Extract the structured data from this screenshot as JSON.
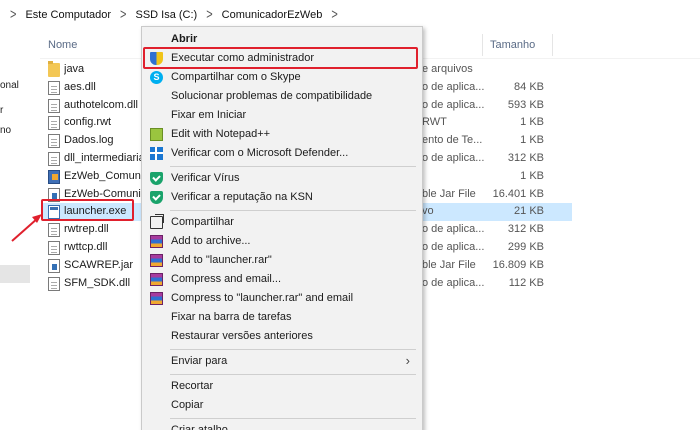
{
  "breadcrumb": [
    "Este Computador",
    "SSD Isa (C:)",
    "ComunicadorEzWeb"
  ],
  "sidebar_fragments": [
    "onal",
    "r",
    "no"
  ],
  "columns": {
    "name": "Nome",
    "size": "Tamanho"
  },
  "files": [
    {
      "name": "java",
      "type": "e arquivos",
      "size": "",
      "icon": "folder-icon"
    },
    {
      "name": "aes.dll",
      "type": "o de aplica...",
      "size": "84 KB",
      "icon": "file-icon"
    },
    {
      "name": "authotelcom.dll",
      "type": "o de aplica...",
      "size": "593 KB",
      "icon": "file-icon"
    },
    {
      "name": "config.rwt",
      "type": "RWT",
      "size": "1 KB",
      "icon": "file-icon"
    },
    {
      "name": "Dados.log",
      "type": "ento de Te...",
      "size": "1 KB",
      "icon": "file-icon"
    },
    {
      "name": "dll_intermediaria.",
      "type": "o de aplica...",
      "size": "312 KB",
      "icon": "file-icon"
    },
    {
      "name": "EzWeb_Comunic",
      "type": "",
      "size": "1 KB",
      "icon": "ezweb-icon"
    },
    {
      "name": "EzWeb-Comunic",
      "type": "ble Jar File",
      "size": "16.401 KB",
      "icon": "jar-icon"
    },
    {
      "name": "launcher.exe",
      "type": "vo",
      "size": "21 KB",
      "icon": "exe-icon",
      "selected": true
    },
    {
      "name": "rwtrep.dll",
      "type": "o de aplica...",
      "size": "312 KB",
      "icon": "file-icon"
    },
    {
      "name": "rwttcp.dll",
      "type": "o de aplica...",
      "size": "299 KB",
      "icon": "file-icon"
    },
    {
      "name": "SCAWREP.jar",
      "type": "ble Jar File",
      "size": "16.809 KB",
      "icon": "jar-icon"
    },
    {
      "name": "SFM_SDK.dll",
      "type": "o de aplica...",
      "size": "112 KB",
      "icon": "file-icon"
    }
  ],
  "menu": [
    {
      "label": "Abrir",
      "bold": true,
      "icon": ""
    },
    {
      "label": "Executar como administrador",
      "icon": "uac-shield-icon"
    },
    {
      "label": "Compartilhar com o Skype",
      "icon": "skype-icon"
    },
    {
      "label": "Solucionar problemas de compatibilidade",
      "icon": ""
    },
    {
      "label": "Fixar em Iniciar",
      "icon": ""
    },
    {
      "label": "Edit with Notepad++",
      "icon": "notepad-plus-icon"
    },
    {
      "label": "Verificar com o Microsoft Defender...",
      "icon": "defender-icon"
    },
    {
      "sep": true
    },
    {
      "label": "Verificar Vírus",
      "icon": "kaspersky-icon"
    },
    {
      "label": "Verificar a reputação na KSN",
      "icon": "kaspersky-icon"
    },
    {
      "sep": true
    },
    {
      "label": "Compartilhar",
      "icon": "share-icon"
    },
    {
      "label": "Add to archive...",
      "icon": "winrar-icon"
    },
    {
      "label": "Add to \"launcher.rar\"",
      "icon": "winrar-icon"
    },
    {
      "label": "Compress and email...",
      "icon": "winrar-icon"
    },
    {
      "label": "Compress to \"launcher.rar\" and email",
      "icon": "winrar-icon"
    },
    {
      "label": "Fixar na barra de tarefas",
      "icon": ""
    },
    {
      "label": "Restaurar versões anteriores",
      "icon": ""
    },
    {
      "sep": true
    },
    {
      "label": "Enviar para",
      "icon": "",
      "submenu": true
    },
    {
      "sep": true
    },
    {
      "label": "Recortar",
      "icon": ""
    },
    {
      "label": "Copiar",
      "icon": ""
    },
    {
      "sep": true
    },
    {
      "label": "Criar atalho",
      "icon": ""
    }
  ]
}
